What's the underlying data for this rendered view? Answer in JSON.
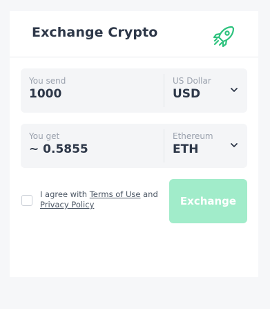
{
  "header": {
    "title": "Exchange Crypto"
  },
  "send": {
    "label": "You send",
    "amount": "1000",
    "currency_name": "US Dollar",
    "currency_code": "USD"
  },
  "get": {
    "label": "You get",
    "amount": "~ 0.5855",
    "currency_name": "Ethereum",
    "currency_code": "ETH"
  },
  "agreement": {
    "prefix": "I agree with ",
    "terms_link": "Terms of Use",
    "and": " and",
    "privacy_link": "Privacy Policy",
    "checked": false
  },
  "actions": {
    "exchange_label": "Exchange"
  },
  "colors": {
    "accent": "#2ec27e",
    "button_disabled": "#a1ecca",
    "title_text": "#2d3748",
    "field_bg": "#f4f5f7"
  },
  "icons": {
    "logo": "rocket-icon",
    "dropdown": "chevron-down-icon"
  }
}
